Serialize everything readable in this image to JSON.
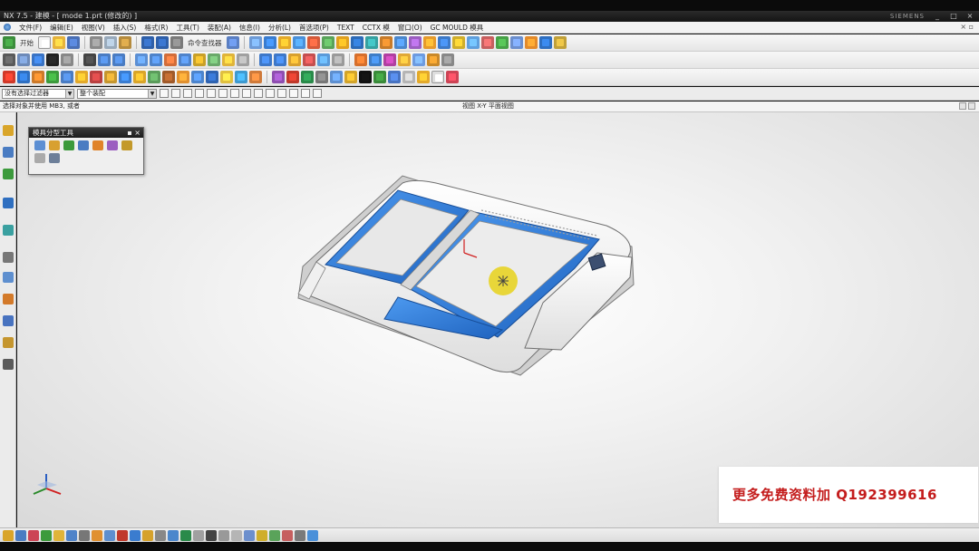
{
  "window": {
    "title": "NX 7.5 - 建模 - [ mode 1.prt (修改的) ]",
    "brand": "SIEMENS",
    "controls": [
      "_",
      "□",
      "×"
    ]
  },
  "menubar": {
    "items": [
      "文件(F)",
      "编辑(E)",
      "视图(V)",
      "插入(S)",
      "格式(R)",
      "工具(T)",
      "装配(A)",
      "信息(I)",
      "分析(L)",
      "首选项(P)",
      "TEXT",
      "CCTX 模",
      "窗口(O)",
      "GC MOULD 模具"
    ]
  },
  "toolbar": {
    "start_label": "开始",
    "command_finder_label": "命令查找器"
  },
  "selection_bar": {
    "filter_value": "没有选择过滤器",
    "scope_value": "整个装配"
  },
  "status": {
    "prompt": "选择对象并使用 MB3, 或者",
    "center_text": "视图 X-Y 平面视图"
  },
  "float_panel": {
    "title": "模具分型工具"
  },
  "colors": {
    "accent_blue": "#2f7fd8",
    "part_white": "#f7f7f7",
    "ad_red": "#c41d1d",
    "cursor_yellow": "#e8d21a"
  },
  "overlay": {
    "ad_text": "更多免费资料加 Q192399616"
  }
}
